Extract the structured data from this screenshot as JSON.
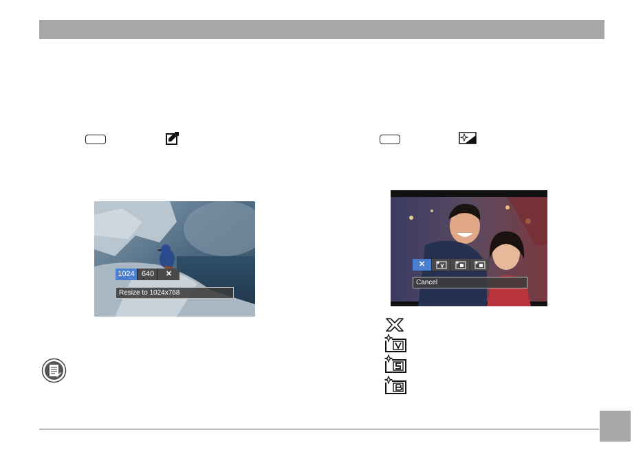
{
  "page": {
    "page_number": ""
  },
  "left": {
    "menu_icon": "resize-edit-icon",
    "resize_options": [
      "1024",
      "640"
    ],
    "cancel_glyph": "✕",
    "selected_index": 0,
    "caption": "Resize to 1024x768"
  },
  "right": {
    "menu_icon": "sparkle-enhance-icon",
    "cancel_glyph": "✕",
    "selected_index": 0,
    "caption": "Cancel",
    "legend": [
      {
        "icon": "cancel-x-icon"
      },
      {
        "icon": "enhance-v-icon",
        "letter": "V"
      },
      {
        "icon": "enhance-s-icon",
        "letter": "S"
      },
      {
        "icon": "enhance-b-icon",
        "letter": "B"
      }
    ]
  },
  "colors": {
    "header": "#a8a8a8",
    "osd_selected": "#4a7fd0",
    "osd_unselected": "#4a4a4a"
  },
  "note_icon": "memo-note-icon"
}
